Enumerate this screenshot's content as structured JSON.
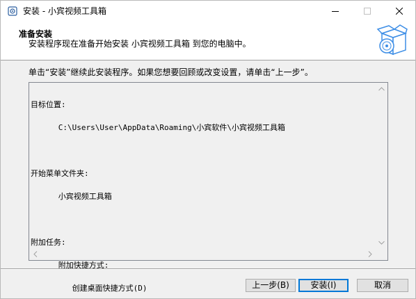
{
  "window": {
    "title": "安装 - 小宾视频工具箱",
    "controls": {
      "minimize_icon": "minimize-icon",
      "maximize_icon": "maximize-icon",
      "close_icon": "close-icon"
    }
  },
  "header": {
    "title": "准备安装",
    "subtitle": "安装程序现在准备开始安装 小宾视频工具箱 到您的电脑中。",
    "logo_icon": "installer-box-icon"
  },
  "main": {
    "instruction": "单击“安装”继续此安装程序。如果您想要回顾或改变设置，请单击“上一步”。",
    "memo_lines": [
      "目标位置:",
      "      C:\\Users\\User\\AppData\\Roaming\\小宾软件\\小宾视频工具箱",
      "",
      "开始菜单文件夹:",
      "      小宾视频工具箱",
      "",
      "附加任务:",
      "      附加快捷方式:",
      "         创建桌面快捷方式(D)"
    ]
  },
  "buttons": {
    "back": "上一步(B)",
    "install": "安装(I)",
    "cancel": "取消"
  },
  "colors": {
    "accent": "#0078d7",
    "window_bg": "#f0f0f0",
    "header_bg": "#ffffff",
    "logo_blue": "#3d8ee6"
  }
}
